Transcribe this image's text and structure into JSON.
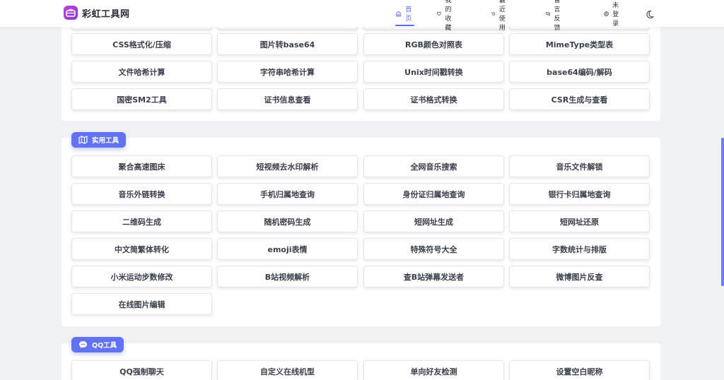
{
  "brand": {
    "name": "彩虹工具网",
    "accent": "#5b6cf2"
  },
  "nav": {
    "home": "首页",
    "favorites": "我的收藏",
    "recent": "最近使用",
    "feedback": "留言反馈",
    "login": "未登录"
  },
  "groups": {
    "top_tools": [
      "CSS格式化/压缩",
      "图片转base64",
      "RGB颜色对照表",
      "MimeType类型表",
      "文件哈希计算",
      "字符串哈希计算",
      "Unix时间戳转换",
      "base64编码/解码",
      "国密SM2工具",
      "证书信息查看",
      "证书格式转换",
      "CSR生成与查看"
    ],
    "practical": {
      "title": "实用工具",
      "tools": [
        "聚合高速图床",
        "短视频去水印解析",
        "全网音乐搜索",
        "音乐文件解锁",
        "音乐外链转换",
        "手机归属地查询",
        "身份证归属地查询",
        "银行卡归属地查询",
        "二维码生成",
        "随机密码生成",
        "短网址生成",
        "短网址还原",
        "中文简繁体转化",
        "emoji表情",
        "特殊符号大全",
        "字数统计与排版",
        "小米运动步数修改",
        "B站视频解析",
        "查B站弹幕发送者",
        "微博图片反查",
        "在线图片编辑"
      ]
    },
    "qq": {
      "title": "QQ工具",
      "tools": [
        "QQ强制聊天",
        "自定义在线机型",
        "单向好友检测",
        "设置空白昵称"
      ]
    }
  }
}
